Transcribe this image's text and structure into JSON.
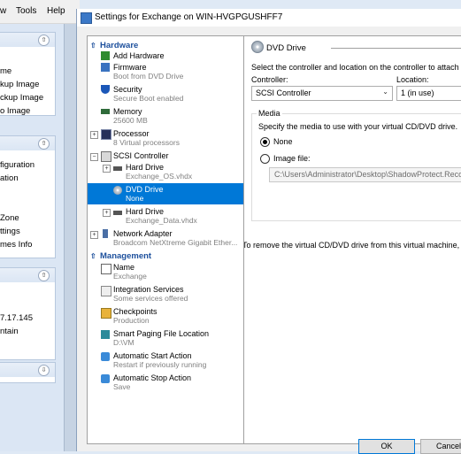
{
  "background_window": {
    "menu": [
      "w",
      "Tools",
      "Help"
    ],
    "panel1": {
      "items": [
        "me",
        "kup Image",
        "ckup Image",
        "o Image"
      ]
    },
    "panel2": {
      "items": [
        "figuration",
        "ation",
        "Zone",
        "ttings",
        "mes Info"
      ]
    },
    "panel3": {
      "items": [
        "7.17.145",
        "ntain"
      ]
    }
  },
  "dialog": {
    "title": "Settings for Exchange on WIN-HVGPGUSHFF7",
    "hardware_header": "Hardware",
    "management_header": "Management",
    "hardware_items": [
      {
        "name": "add-hardware",
        "label": "Add Hardware",
        "sub": ""
      },
      {
        "name": "firmware",
        "label": "Firmware",
        "sub": "Boot from DVD Drive"
      },
      {
        "name": "security",
        "label": "Security",
        "sub": "Secure Boot enabled"
      },
      {
        "name": "memory",
        "label": "Memory",
        "sub": "25600 MB"
      },
      {
        "name": "processor",
        "label": "Processor",
        "sub": "8 Virtual processors"
      },
      {
        "name": "scsi-controller",
        "label": "SCSI Controller",
        "sub": ""
      },
      {
        "name": "hard-drive-os",
        "label": "Hard Drive",
        "sub": "Exchange_OS.vhdx"
      },
      {
        "name": "dvd-drive",
        "label": "DVD Drive",
        "sub": "None"
      },
      {
        "name": "hard-drive-data",
        "label": "Hard Drive",
        "sub": "Exchange_Data.vhdx"
      },
      {
        "name": "network-adapter",
        "label": "Network Adapter",
        "sub": "Broadcom NetXtreme Gigabit Ether..."
      }
    ],
    "management_items": [
      {
        "name": "vm-name",
        "label": "Name",
        "sub": "Exchange"
      },
      {
        "name": "integration-services",
        "label": "Integration Services",
        "sub": "Some services offered"
      },
      {
        "name": "checkpoints",
        "label": "Checkpoints",
        "sub": "Production"
      },
      {
        "name": "smart-paging",
        "label": "Smart Paging File Location",
        "sub": "D:\\VM"
      },
      {
        "name": "auto-start",
        "label": "Automatic Start Action",
        "sub": "Restart if previously running"
      },
      {
        "name": "auto-stop",
        "label": "Automatic Stop Action",
        "sub": "Save"
      }
    ],
    "panel": {
      "heading": "DVD Drive",
      "description": "Select the controller and location on the controller to attach the C",
      "controller_label": "Controller:",
      "controller_value": "SCSI Controller",
      "location_label": "Location:",
      "location_value": "1 (in use)",
      "media_label": "Media",
      "media_desc": "Specify the media to use with your virtual CD/DVD drive.",
      "none_label": "None",
      "image_label": "Image file:",
      "image_path": "C:\\Users\\Administrator\\Desktop\\ShadowProtect.Recovery",
      "remove_text": "To remove the virtual CD/DVD drive from this virtual machine, click"
    },
    "buttons": {
      "ok": "OK",
      "cancel": "Cancel"
    }
  },
  "colors": {
    "section_header": "#1c4f9c",
    "selection": "#0078d7"
  },
  "icons": [
    "add-hardware-icon",
    "firmware-icon",
    "shield-icon",
    "memory-icon",
    "processor-icon",
    "scsi-icon",
    "hard-drive-icon",
    "dvd-icon",
    "network-icon",
    "name-icon",
    "integration-icon",
    "checkpoint-icon",
    "paging-icon",
    "start-icon",
    "stop-icon"
  ]
}
